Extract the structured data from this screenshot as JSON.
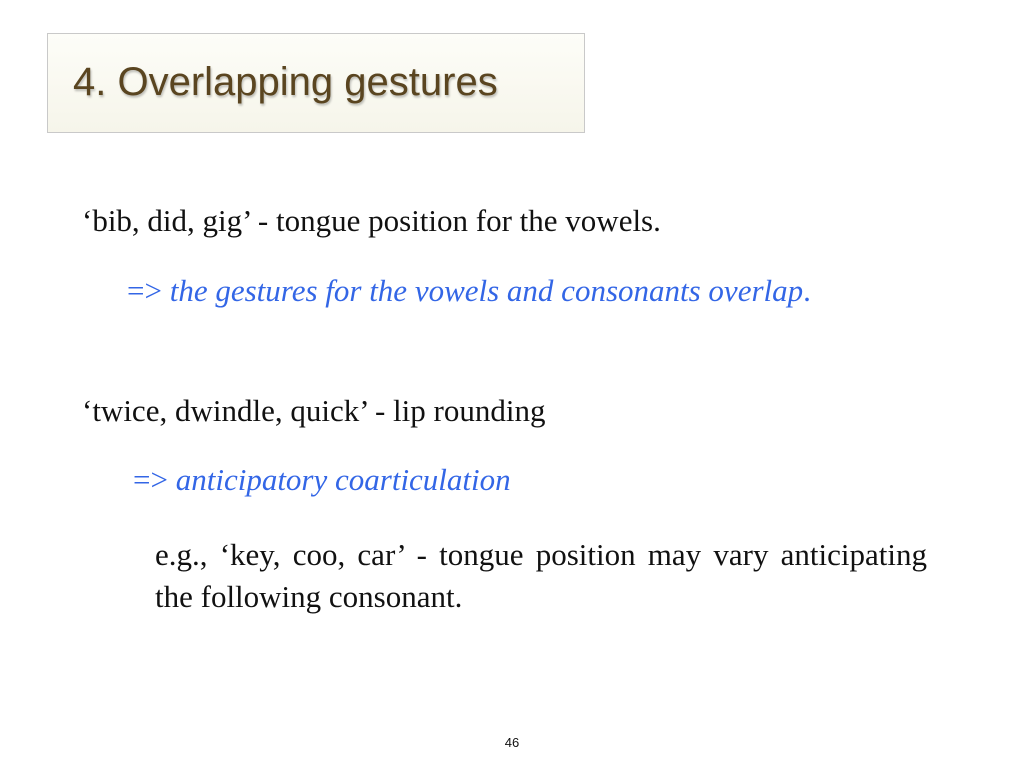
{
  "slide": {
    "title": "4. Overlapping gestures",
    "lines": [
      {
        "text": "‘bib, did, gig’ - tongue position for the vowels."
      },
      {
        "arrow": "=>",
        "text": "the gestures for the vowels and consonants overlap",
        "suffix": "."
      },
      {
        "text": "‘twice, dwindle, quick’ - lip rounding"
      },
      {
        "arrow": "=>",
        "text": "anticipatory coarticulation"
      }
    ],
    "example": "e.g., ‘key, coo, car’ - tongue position may vary anticipating the following consonant.",
    "page_number": "46"
  },
  "colors": {
    "title_text": "#5a4520",
    "body_text": "#111111",
    "accent_blue": "#3366e6",
    "title_box_border": "#c9c9c9"
  }
}
